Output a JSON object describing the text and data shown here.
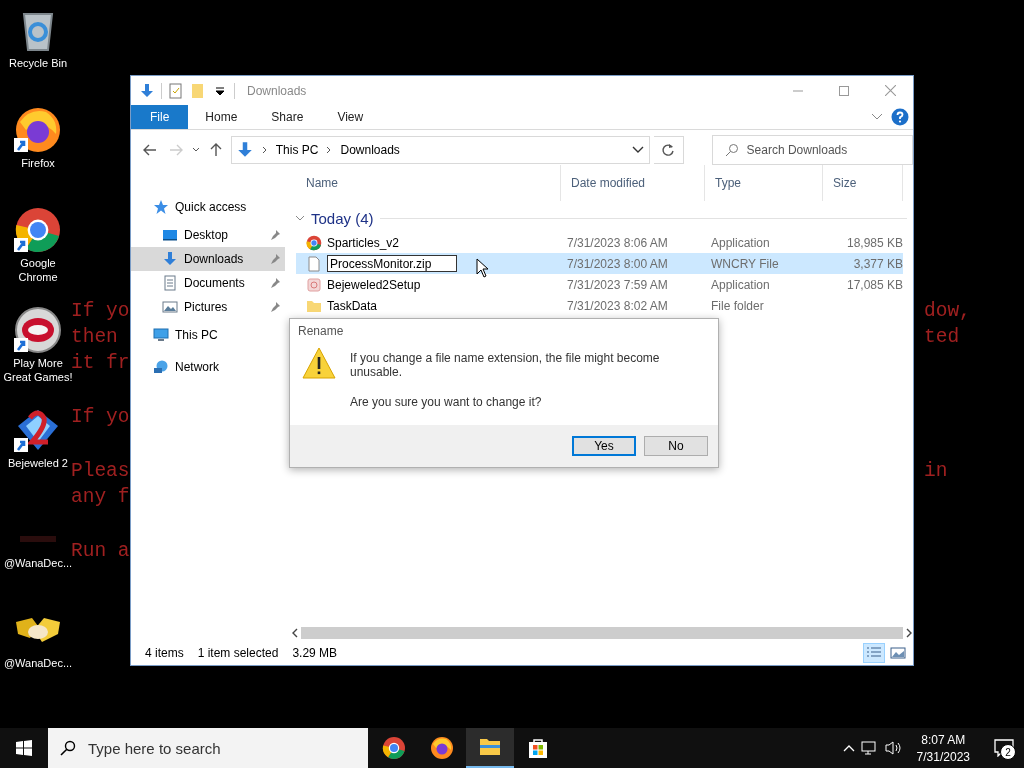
{
  "desktop": {
    "icons": [
      {
        "label": "Recycle Bin",
        "kind": "recycle",
        "shortcut": false
      },
      {
        "label": "Firefox",
        "kind": "firefox",
        "shortcut": true
      },
      {
        "label": "Google Chrome",
        "kind": "chrome",
        "shortcut": true
      },
      {
        "label": "Play More Great Games!",
        "kind": "popcap",
        "shortcut": true
      },
      {
        "label": "Bejeweled 2",
        "kind": "bejeweled",
        "shortcut": true
      },
      {
        "label": "@WanaDec...",
        "kind": "dark",
        "shortcut": false
      },
      {
        "label": "@WanaDec...",
        "kind": "handshake",
        "shortcut": false
      }
    ],
    "wallpaper_paragraphs": [
      [
        {
          "left": "If yo",
          "right": "dow,"
        },
        {
          "left": "then",
          "right": "ted"
        },
        {
          "left": "it fr"
        }
      ],
      [
        {
          "left": "If yo"
        }
      ],
      [
        {
          "left": "Pleas",
          "right": "in"
        },
        {
          "left": "any f"
        }
      ],
      [
        {
          "left": "Run a"
        }
      ]
    ]
  },
  "explorer": {
    "title": "Downloads",
    "ribbon_tabs": [
      {
        "label": "File",
        "kind": "menu"
      },
      {
        "label": "Home",
        "kind": "tab"
      },
      {
        "label": "Share",
        "kind": "tab"
      },
      {
        "label": "View",
        "kind": "tab"
      }
    ],
    "breadcrumb": [
      "This PC",
      "Downloads"
    ],
    "search": {
      "placeholder": "Search Downloads"
    },
    "nav": [
      {
        "label": "Quick access",
        "kind": "star",
        "selected": false,
        "children": [
          {
            "label": "Desktop",
            "kind": "desktop",
            "pinned": true,
            "selected": false
          },
          {
            "label": "Downloads",
            "kind": "download",
            "pinned": true,
            "selected": true
          },
          {
            "label": "Documents",
            "kind": "document",
            "pinned": true,
            "selected": false
          },
          {
            "label": "Pictures",
            "kind": "pictures",
            "pinned": true,
            "selected": false
          }
        ]
      },
      {
        "label": "This PC",
        "kind": "pc",
        "selected": false
      },
      {
        "label": "Network",
        "kind": "network",
        "selected": false
      }
    ],
    "columns": [
      "Name",
      "Date modified",
      "Type",
      "Size"
    ],
    "group": {
      "label": "Today (4)",
      "expanded": true
    },
    "files": [
      {
        "name": "Sparticles_v2",
        "kind": "sparkle",
        "date": "7/31/2023 8:06 AM",
        "type": "Application",
        "size": "18,985 KB",
        "selected": false,
        "renaming": false
      },
      {
        "name": "ProcessMonitor.zip",
        "kind": "page",
        "date": "7/31/2023 8:00 AM",
        "type": "WNCRY File",
        "size": "3,377 KB",
        "selected": true,
        "renaming": true
      },
      {
        "name": "Bejeweled2Setup",
        "kind": "gem",
        "date": "7/31/2023 7:59 AM",
        "type": "Application",
        "size": "17,085 KB",
        "selected": false,
        "renaming": false
      },
      {
        "name": "TaskData",
        "kind": "folder",
        "date": "7/31/2023 8:02 AM",
        "type": "File folder",
        "selected": false,
        "renaming": false
      }
    ],
    "status": [
      "4 items",
      "1 item selected",
      "3.29 MB"
    ],
    "views": [
      {
        "kind": "details",
        "selected": true
      },
      {
        "kind": "large",
        "selected": false
      }
    ]
  },
  "dialog": {
    "title": "Rename",
    "message": "If you change a file name extension, the file might become unusable.",
    "question": "Are you sure you want to change it?",
    "buttons": [
      {
        "label": "Yes",
        "default": true
      },
      {
        "label": "No",
        "default": false
      }
    ]
  },
  "taskbar": {
    "search": {
      "placeholder": "Type here to search"
    },
    "apps": [
      {
        "kind": "chrome",
        "active": false
      },
      {
        "kind": "firefox",
        "active": false
      },
      {
        "kind": "explorer",
        "active": true
      },
      {
        "kind": "store",
        "active": false
      }
    ],
    "time": "8:07 AM",
    "date": "7/31/2023",
    "notifications": "2"
  }
}
